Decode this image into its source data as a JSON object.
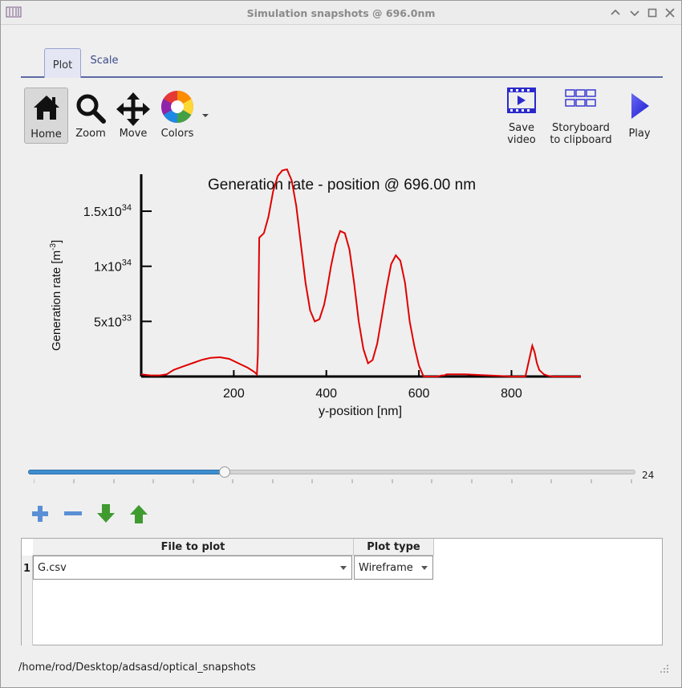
{
  "window": {
    "title": "Simulation snapshots @ 696.0nm"
  },
  "tabs": [
    {
      "label": "Plot",
      "active": true
    },
    {
      "label": "Scale",
      "active": false
    }
  ],
  "toolbar": {
    "home": "Home",
    "zoom": "Zoom",
    "move": "Move",
    "colors": "Colors",
    "save_video_line1": "Save",
    "save_video_line2": "video",
    "storyboard_line1": "Storyboard",
    "storyboard_line2": "to clipboard",
    "play": "Play"
  },
  "chart_data": {
    "type": "line",
    "title": "Generation rate - position @ 696.00 nm",
    "xlabel": "y-position [nm]",
    "ylabel_main": "Generation rate [m",
    "ylabel_exp": "-3",
    "ylabel_end": "]",
    "xlim": [
      0,
      950
    ],
    "ylim": [
      0,
      1.85e+34
    ],
    "xticks": [
      200,
      400,
      600,
      800
    ],
    "yticks": [
      5e+33,
      1e+34,
      1.5e+34
    ],
    "ytick_labels": [
      {
        "base": "5x10",
        "exp": "33"
      },
      {
        "base": "1x10",
        "exp": "34"
      },
      {
        "base": "1.5x10",
        "exp": "34"
      }
    ],
    "line_color": "#e00000",
    "series": [
      {
        "x": [
          0,
          20,
          40,
          55,
          70,
          90,
          110,
          130,
          150,
          170,
          190,
          210,
          230,
          245,
          250,
          252,
          255,
          265,
          275,
          285,
          295,
          305,
          315,
          325,
          335,
          345,
          355,
          365,
          375,
          385,
          395,
          400,
          410,
          420,
          430,
          440,
          450,
          460,
          470,
          480,
          490,
          500,
          510,
          520,
          530,
          540,
          550,
          560,
          570,
          580,
          590,
          600,
          610,
          620,
          630,
          640,
          650,
          655,
          660,
          700,
          750,
          800,
          830,
          845,
          850,
          855,
          860,
          870,
          880,
          890,
          900,
          950
        ],
        "y": [
          2e+32,
          1e+32,
          1e+32,
          2e+32,
          6e+32,
          9e+32,
          1.2e+33,
          1.5e+33,
          1.7e+33,
          1.75e+33,
          1.6e+33,
          1.2e+33,
          8e+32,
          4e+32,
          2e+32,
          2e+33,
          1.26e+34,
          1.3e+34,
          1.45e+34,
          1.68e+34,
          1.82e+34,
          1.87e+34,
          1.88e+34,
          1.78e+34,
          1.55e+34,
          1.2e+34,
          8.5e+33,
          6e+33,
          5e+33,
          5.2e+33,
          6.5e+33,
          7.5e+33,
          1e+34,
          1.2e+34,
          1.32e+34,
          1.3e+34,
          1.15e+34,
          8.5e+33,
          5e+33,
          2.5e+33,
          1.2e+33,
          1.5e+33,
          3e+33,
          5.5e+33,
          8e+33,
          1.02e+34,
          1.1e+34,
          1.05e+34,
          8.5e+33,
          5e+33,
          2.8e+33,
          1e+33,
          0,
          0,
          0,
          0,
          1e+32,
          1e+32,
          2e+32,
          2e+32,
          1e+32,
          0,
          0,
          2.8e+33,
          2.2e+33,
          1.2e+33,
          6e+32,
          2e+32,
          5e+31,
          0,
          0,
          0
        ]
      }
    ]
  },
  "slider": {
    "value": "24",
    "fraction": 0.325
  },
  "table": {
    "headers": [
      "File to plot",
      "Plot type"
    ],
    "rows": [
      {
        "num": "1",
        "file": "G.csv",
        "plot_type": "Wireframe"
      }
    ]
  },
  "status": {
    "path": "/home/rod/Desktop/adsasd/optical_snapshots"
  }
}
